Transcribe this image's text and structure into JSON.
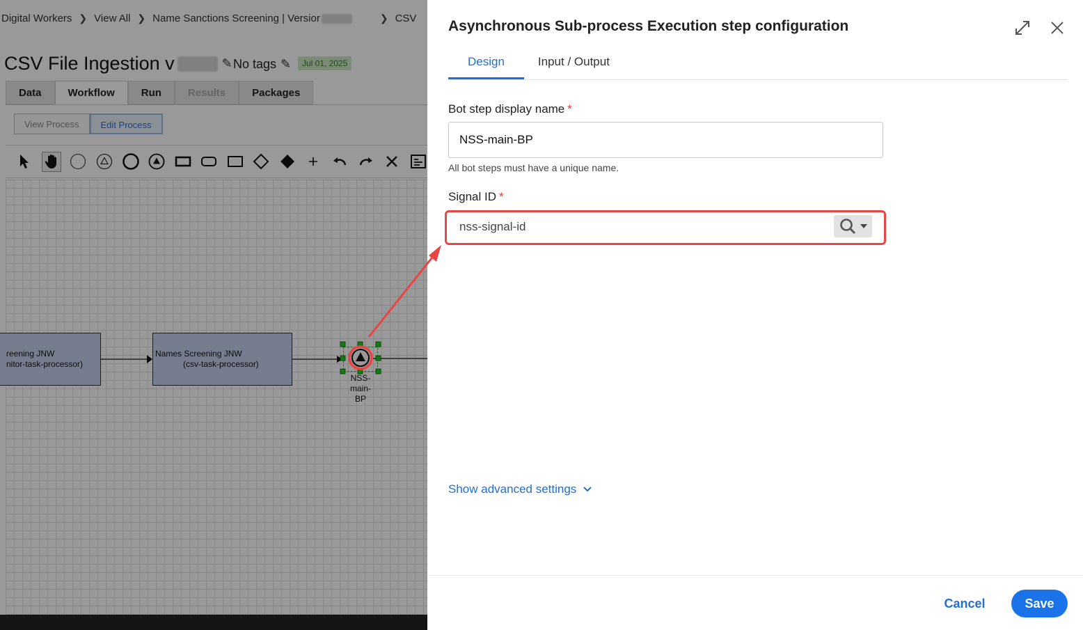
{
  "background_app": {
    "breadcrumb": [
      "Digital Workers",
      "View All",
      "Name Sanctions Screening | Versior",
      "CSV"
    ],
    "page_title": "CSV File Ingestion v",
    "tags_label": "No tags",
    "date_badge": "Jul 01, 2025",
    "tabs": [
      {
        "label": "Data",
        "state": "normal"
      },
      {
        "label": "Workflow",
        "state": "active"
      },
      {
        "label": "Run",
        "state": "normal"
      },
      {
        "label": "Results",
        "state": "disabled"
      },
      {
        "label": "Packages",
        "state": "normal"
      }
    ],
    "subtabs": [
      {
        "label": "View Process",
        "state": "normal"
      },
      {
        "label": "Edit Process",
        "state": "active"
      }
    ],
    "diagram": {
      "task1": {
        "line1": "reening JNW",
        "line2": "nitor-task-processor)"
      },
      "task2": {
        "line1": "Names Screening JNW",
        "line2": "(csv-task-processor)"
      },
      "event_lines": [
        "NSS-",
        "main-",
        "BP"
      ]
    }
  },
  "panel": {
    "title": "Asynchronous Sub-process Execution step configuration",
    "tabs": [
      {
        "label": "Design",
        "active": true
      },
      {
        "label": "Input / Output",
        "active": false
      }
    ],
    "display_name_label": "Bot step display name",
    "required_mark": "*",
    "display_name_value": "NSS-main-BP",
    "display_name_hint": "All bot steps must have a unique name.",
    "signal_label": "Signal ID",
    "signal_value": "nss-signal-id",
    "advanced_link": "Show advanced settings",
    "cancel_label": "Cancel",
    "save_label": "Save"
  },
  "colors": {
    "accent": "#1a73e8",
    "highlight": "#e84545",
    "required": "#e53935",
    "task_fill": "#c5d0ee",
    "date_badge_bg": "#cfe8c6"
  }
}
